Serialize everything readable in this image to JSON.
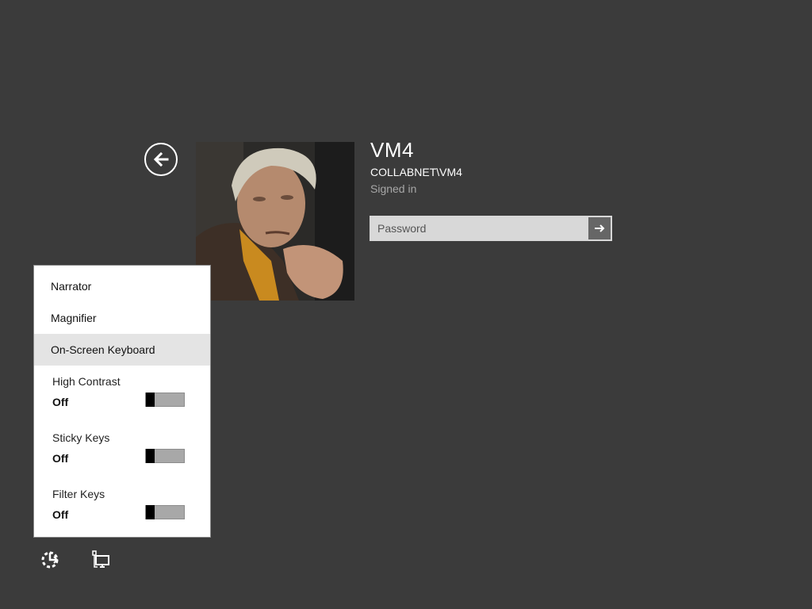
{
  "user": {
    "name": "VM4",
    "domain": "COLLABNET\\VM4",
    "status": "Signed in"
  },
  "password": {
    "placeholder": "Password",
    "value": ""
  },
  "ease_of_access_menu": {
    "items": [
      {
        "label": "Narrator"
      },
      {
        "label": "Magnifier"
      },
      {
        "label": "On-Screen Keyboard"
      }
    ],
    "toggles": [
      {
        "label": "High Contrast",
        "state": "Off"
      },
      {
        "label": "Sticky Keys",
        "state": "Off"
      },
      {
        "label": "Filter Keys",
        "state": "Off"
      }
    ]
  },
  "icons": {
    "back": "back-arrow-icon",
    "submit": "arrow-right-icon",
    "ease_of_access": "ease-of-access-icon",
    "network": "network-icon"
  },
  "colors": {
    "background": "#3b3b3b",
    "menu_background": "#ffffff",
    "menu_hover": "#e4e4e4",
    "password_field": "#d8d8d8",
    "submit_button": "#666666"
  }
}
